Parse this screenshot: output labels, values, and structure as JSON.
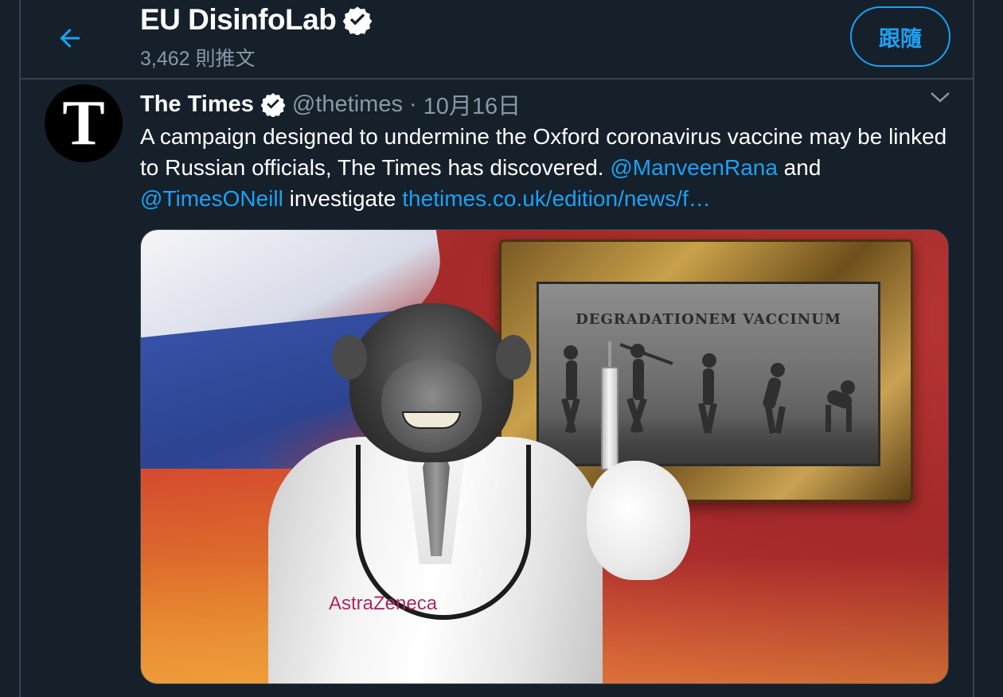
{
  "header": {
    "back_icon": "arrow-left-icon",
    "profile_name": "EU DisinfoLab",
    "verified_icon": "verified-badge-icon",
    "tweet_count": "3,462 則推文",
    "follow_label": "跟隨"
  },
  "tweet": {
    "author_name": "The Times",
    "author_handle": "@thetimes",
    "separator": "·",
    "date": "10月16日",
    "avatar_letter": "T",
    "text_part1": "A campaign designed to undermine the Oxford coronavirus vaccine may be linked to Russian officials, The Times has discovered. ",
    "mention1": "@ManveenRana",
    "text_part2": " and ",
    "mention2": "@TimesONeill",
    "text_part3": " investigate ",
    "link": "thetimes.co.uk/edition/news/f…",
    "caret_icon": "chevron-down-icon"
  },
  "media": {
    "painting_title": "DEGRADATIONEM VACCINUM",
    "coat_logo": "AstraZeneca"
  },
  "colors": {
    "background": "#15202b",
    "border": "#38444d",
    "accent": "#1da1f2",
    "secondary_text": "#8899a6"
  }
}
